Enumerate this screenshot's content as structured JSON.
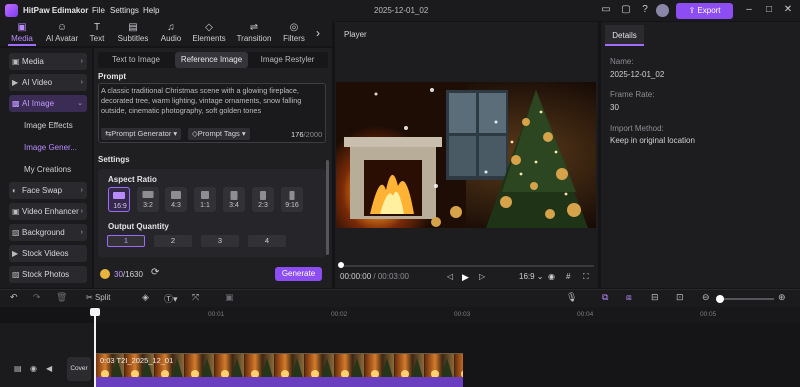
{
  "app": {
    "title": "HitPaw Edimakor",
    "project_name": "2025-12-01_02",
    "export_label": "Export"
  },
  "menu": [
    "File",
    "Settings",
    "Help"
  ],
  "toolbar": {
    "items": [
      {
        "label": "Media",
        "icon": "media-icon"
      },
      {
        "label": "AI Avatar",
        "icon": "avatar-icon"
      },
      {
        "label": "Text",
        "icon": "text-icon"
      },
      {
        "label": "Subtitles",
        "icon": "subtitles-icon"
      },
      {
        "label": "Audio",
        "icon": "audio-icon"
      },
      {
        "label": "Elements",
        "icon": "elements-icon"
      },
      {
        "label": "Transition",
        "icon": "transition-icon"
      },
      {
        "label": "Filters",
        "icon": "filters-icon"
      }
    ]
  },
  "sidebar": {
    "items": [
      {
        "label": "Media"
      },
      {
        "label": "AI Video"
      },
      {
        "label": "AI Image"
      },
      {
        "label": "Face Swap"
      },
      {
        "label": "Video Enhancer"
      },
      {
        "label": "Background"
      },
      {
        "label": "Stock Videos"
      },
      {
        "label": "Stock Photos"
      }
    ],
    "sub_items": [
      "Image Effects",
      "Image Gener...",
      "My Creations"
    ]
  },
  "ai_panel": {
    "tabs": [
      "Text to Image",
      "Reference Image",
      "Image Restyler"
    ],
    "prompt_label": "Prompt",
    "prompt_text": "A classic traditional Christmas scene with a glowing fireplace, decorated tree, warm lighting, vintage ornaments, snow falling outside, cinematic photography, soft golden tones",
    "prompt_generator": "Prompt Generator",
    "prompt_tags": "Prompt Tags",
    "char_count": "176",
    "char_max": "/2000",
    "settings_label": "Settings",
    "aspect_label": "Aspect Ratio",
    "ratios": [
      "16:9",
      "3:2",
      "4:3",
      "1:1",
      "3:4",
      "2:3",
      "9:16"
    ],
    "quantity_label": "Output Quantity",
    "quantities": [
      "1",
      "2",
      "3",
      "4"
    ],
    "credits_used": "30",
    "credits_total": "/1630",
    "generate_label": "Generate"
  },
  "player": {
    "title": "Player",
    "current_time": "00:00:00",
    "total_time": "/ 00:03:00",
    "ratio": "16:9"
  },
  "details": {
    "tab": "Details",
    "name_label": "Name:",
    "name_value": "2025-12-01_02",
    "frame_rate_label": "Frame Rate:",
    "frame_rate_value": "30",
    "import_label": "Import Method:",
    "import_value": "Keep in original location"
  },
  "timeline": {
    "split_label": "Split",
    "ticks": [
      "00:01",
      "00:02",
      "00:03",
      "00:04",
      "00:05"
    ],
    "cover_label": "Cover",
    "clip_label": "0:03  T2I_2025_12_01"
  },
  "colors": {
    "accent": "#8c4df2",
    "active_text": "#b88bff",
    "background": "#141416"
  }
}
